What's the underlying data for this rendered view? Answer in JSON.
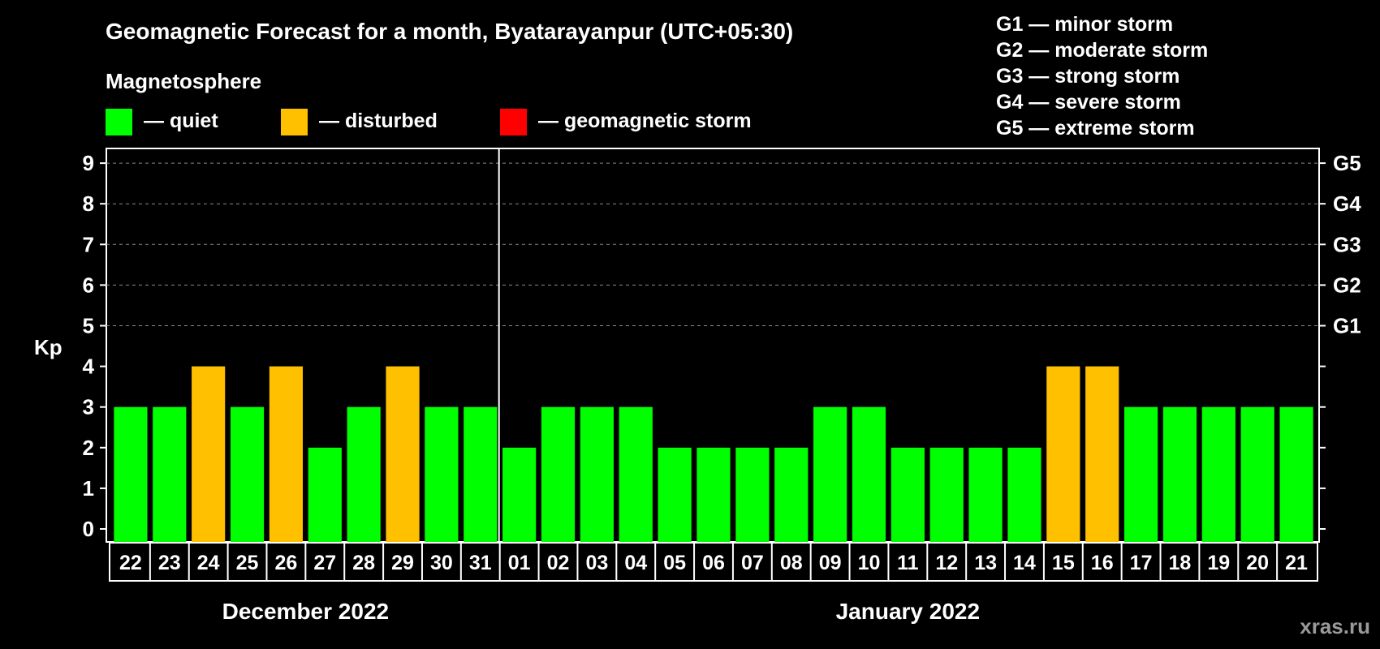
{
  "title": "Geomagnetic Forecast for a month, Byatarayanpur (UTC+05:30)",
  "legend": {
    "heading": "Magnetosphere",
    "items": [
      {
        "label": "— quiet",
        "color": "#00ff00"
      },
      {
        "label": "— disturbed",
        "color": "#ffc000"
      },
      {
        "label": "— geomagnetic storm",
        "color": "#ff0000"
      }
    ]
  },
  "storm_scale": [
    "G1 — minor storm",
    "G2 — moderate storm",
    "G3 — strong storm",
    "G4 — severe storm",
    "G5 — extreme storm"
  ],
  "watermark": "xras.ru",
  "chart_data": {
    "type": "bar",
    "ylabel": "Kp",
    "ylim": [
      0,
      9
    ],
    "yticks": [
      "0",
      "1",
      "2",
      "3",
      "4",
      "5",
      "6",
      "7",
      "8",
      "9"
    ],
    "right_ticks": [
      {
        "value": 5,
        "label": "G1"
      },
      {
        "value": 6,
        "label": "G2"
      },
      {
        "value": 7,
        "label": "G3"
      },
      {
        "value": 8,
        "label": "G4"
      },
      {
        "value": 9,
        "label": "G5"
      }
    ],
    "grid": "dashed horizontal at 5-9",
    "categories": [
      "22",
      "23",
      "24",
      "25",
      "26",
      "27",
      "28",
      "29",
      "30",
      "31",
      "01",
      "02",
      "03",
      "04",
      "05",
      "06",
      "07",
      "08",
      "09",
      "10",
      "11",
      "12",
      "13",
      "14",
      "15",
      "16",
      "17",
      "18",
      "19",
      "20",
      "21"
    ],
    "values": [
      3,
      3,
      4,
      3,
      4,
      2,
      3,
      4,
      3,
      3,
      2,
      3,
      3,
      3,
      2,
      2,
      2,
      2,
      3,
      3,
      2,
      2,
      2,
      2,
      4,
      4,
      3,
      3,
      3,
      3,
      3
    ],
    "status": [
      "quiet",
      "quiet",
      "disturbed",
      "quiet",
      "disturbed",
      "quiet",
      "quiet",
      "disturbed",
      "quiet",
      "quiet",
      "quiet",
      "quiet",
      "quiet",
      "quiet",
      "quiet",
      "quiet",
      "quiet",
      "quiet",
      "quiet",
      "quiet",
      "quiet",
      "quiet",
      "quiet",
      "quiet",
      "disturbed",
      "disturbed",
      "quiet",
      "quiet",
      "quiet",
      "quiet",
      "quiet"
    ],
    "status_colors": {
      "quiet": "#00ff00",
      "disturbed": "#ffc000",
      "storm": "#ff0000"
    },
    "months": [
      {
        "label": "December 2022",
        "first_index": 0,
        "last_index": 9
      },
      {
        "label": "January 2022",
        "first_index": 10,
        "last_index": 30
      }
    ]
  }
}
